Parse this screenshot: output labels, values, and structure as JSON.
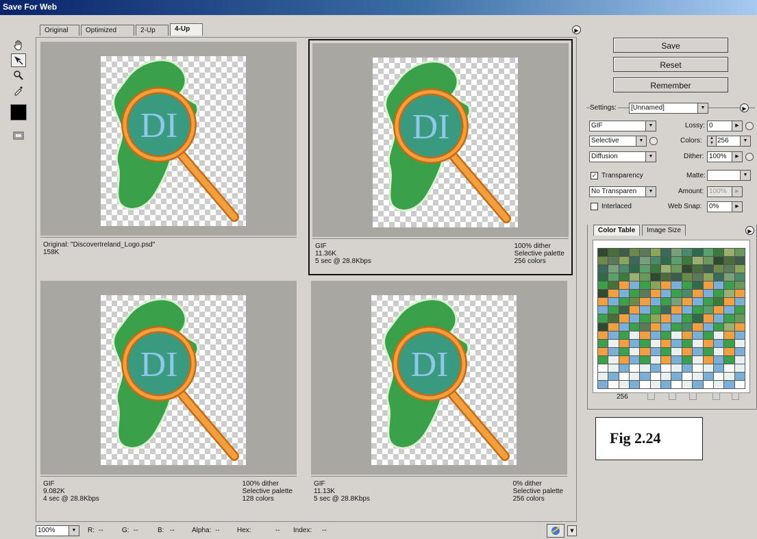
{
  "window": {
    "title": "Save For Web"
  },
  "tabs": [
    {
      "label": "Original"
    },
    {
      "label": "Optimized"
    },
    {
      "label": "2-Up"
    },
    {
      "label": "4-Up"
    }
  ],
  "tools": [
    {
      "icon": "hand-icon"
    },
    {
      "icon": "slice-select-icon"
    },
    {
      "icon": "zoom-icon"
    },
    {
      "icon": "eyedropper-icon"
    },
    {
      "icon": "eyedropper-color-icon"
    },
    {
      "icon": "toggle-slices-icon"
    }
  ],
  "panes": [
    {
      "left_lines": [
        "Original: \"DiscoverIreland_Logo.psd\"",
        "158K"
      ],
      "right_lines": []
    },
    {
      "left_lines": [
        "GIF",
        "11.36K",
        "5 sec @ 28.8Kbps"
      ],
      "right_lines": [
        "100% dither",
        "Selective palette",
        "256 colors"
      ]
    },
    {
      "left_lines": [
        "GIF",
        "9.082K",
        "4 sec @ 28.8Kbps"
      ],
      "right_lines": [
        "100% dither",
        "Selective palette",
        "128 colors"
      ]
    },
    {
      "left_lines": [
        "GIF",
        "11.13K",
        "5 sec @ 28.8Kbps"
      ],
      "right_lines": [
        "0% dither",
        "Selective palette",
        "256 colors"
      ]
    }
  ],
  "logo_text": "DI",
  "buttons": {
    "save": "Save",
    "reset": "Reset",
    "remember": "Remember"
  },
  "settings": {
    "label": "Settings:",
    "value": "[Unnamed]",
    "format": "GIF",
    "lossy_label": "Lossy:",
    "lossy_value": "0",
    "reduction": "Selective",
    "colors_label": "Colors:",
    "colors_value": "256",
    "dither_algo": "Diffusion",
    "dither_label": "Dither:",
    "dither_value": "100%",
    "transparency_label": "Transparency",
    "transparency_checked": true,
    "matte_label": "Matte:",
    "matte_value": "",
    "transparency_dither": "No Transparen",
    "amount_label": "Amount:",
    "amount_value": "100%",
    "interlaced_label": "Interlaced",
    "interlaced_checked": false,
    "websnap_label": "Web Snap:",
    "websnap_value": "0%"
  },
  "color_panel": {
    "tabs": [
      {
        "label": "Color Table"
      },
      {
        "label": "Image Size"
      }
    ],
    "count": "256",
    "colors": [
      "#2f4a2f",
      "#4a6e3a",
      "#3d5c4a",
      "#6b8a4a",
      "#5a7a5a",
      "#8aa65a",
      "#3a6a5a",
      "#7aa07a",
      "#4a8a6a",
      "#2f6a4a",
      "#5aa06a",
      "#3a7a3a",
      "#9ab070",
      "#6a9a5a"
    ],
    "legend_colors": {
      "green": "#3aa04a",
      "orange": "#f0a040",
      "blue": "#7ab0d8",
      "pale": "#e8f0f0"
    }
  },
  "figure_label": "Fig 2.24",
  "status": {
    "zoom": "100%",
    "r_label": "R:",
    "r_value": "--",
    "g_label": "G:",
    "g_value": "--",
    "b_label": "B:",
    "b_value": "--",
    "alpha_label": "Alpha:",
    "alpha_value": "--",
    "hex_label": "Hex:",
    "hex_value": "--",
    "index_label": "Index:",
    "index_value": "--"
  }
}
